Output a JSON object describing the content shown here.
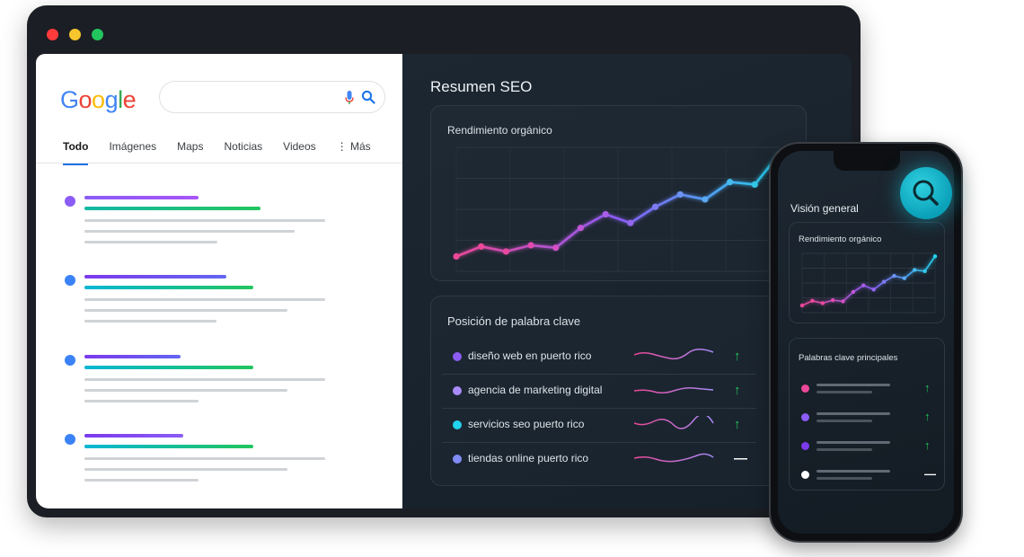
{
  "google": {
    "logo_letters": [
      {
        "char": "G",
        "color": "#4285F4"
      },
      {
        "char": "o",
        "color": "#EA4335"
      },
      {
        "char": "o",
        "color": "#FBBC05"
      },
      {
        "char": "g",
        "color": "#4285F4"
      },
      {
        "char": "l",
        "color": "#34A853"
      },
      {
        "char": "e",
        "color": "#EA4335"
      }
    ],
    "search_value": "",
    "tabs": [
      "Todo",
      "Imágenes",
      "Maps",
      "Noticias",
      "Videos",
      "⋮ Más"
    ]
  },
  "dashboard": {
    "title": "Resumen SEO",
    "organic_card_title": "Rendimiento orgánico",
    "keyword_card_title": "Posición de palabra clave",
    "keywords": [
      {
        "label": "diseño web en puerto rico",
        "dot_color": "#8b5cf6",
        "trend": "↑",
        "trend_color": "#22c55e"
      },
      {
        "label": "agencia de marketing digital",
        "dot_color": "#a78bfa",
        "trend": "↑",
        "trend_color": "#22c55e"
      },
      {
        "label": "servicios seo puerto rico",
        "dot_color": "#22d3ee",
        "trend": "↑",
        "trend_color": "#22c55e"
      },
      {
        "label": "tiendas online puerto rico",
        "dot_color": "#818cf8",
        "trend": "—",
        "trend_color": "#ffffff"
      }
    ]
  },
  "phone": {
    "title": "Visión general",
    "organic_card_title": "Rendimiento orgánico",
    "keywords_card_title": "Palabras clave principales",
    "rows": [
      {
        "dot_color": "#ec4899",
        "trend": "↑",
        "trend_color": "#22c55e"
      },
      {
        "dot_color": "#8b5cf6",
        "trend": "↑",
        "trend_color": "#22c55e"
      },
      {
        "dot_color": "#7c3aed",
        "trend": "↑",
        "trend_color": "#22c55e"
      },
      {
        "dot_color": "#ffffff",
        "trend": "—",
        "trend_color": "#ffffff"
      }
    ]
  },
  "chart_data": {
    "type": "line",
    "title": "Rendimiento orgánico",
    "xlabel": "",
    "ylabel": "",
    "grid": true,
    "series": [
      {
        "values": [
          12,
          20,
          16,
          21,
          19,
          35,
          46,
          39,
          52,
          62,
          58,
          72,
          70,
          95
        ]
      }
    ]
  }
}
